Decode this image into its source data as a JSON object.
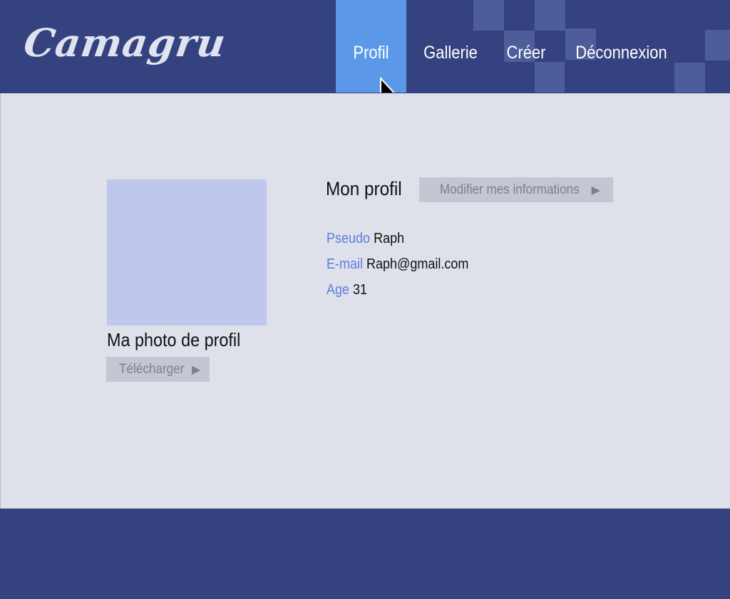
{
  "header": {
    "logo_text": "Camagru",
    "nav": [
      {
        "label": "Profil",
        "active": true
      },
      {
        "label": "Gallerie",
        "active": false
      },
      {
        "label": "Créer",
        "active": false
      },
      {
        "label": "Déconnexion",
        "active": false
      }
    ]
  },
  "photo": {
    "title": "Ma photo de profil",
    "upload_label": "Télécharger"
  },
  "profile": {
    "title": "Mon profil",
    "edit_label": "Modifier mes informations",
    "fields": [
      {
        "label": "Pseudo",
        "value": "Raph"
      },
      {
        "label": "E-mail",
        "value": "Raph@gmail.com"
      },
      {
        "label": "Age",
        "value": "31"
      }
    ]
  },
  "colors": {
    "header_bg": "#34427f",
    "active_tab": "#5b99e8",
    "content_bg": "#dfe1ea",
    "photo_placeholder": "#c0c7ec",
    "field_label": "#5c7fdd",
    "button_bg": "#c4c6d2"
  },
  "icons": {
    "button_arrow": "triangle-right-icon",
    "pointer": "mouse-cursor-icon"
  }
}
